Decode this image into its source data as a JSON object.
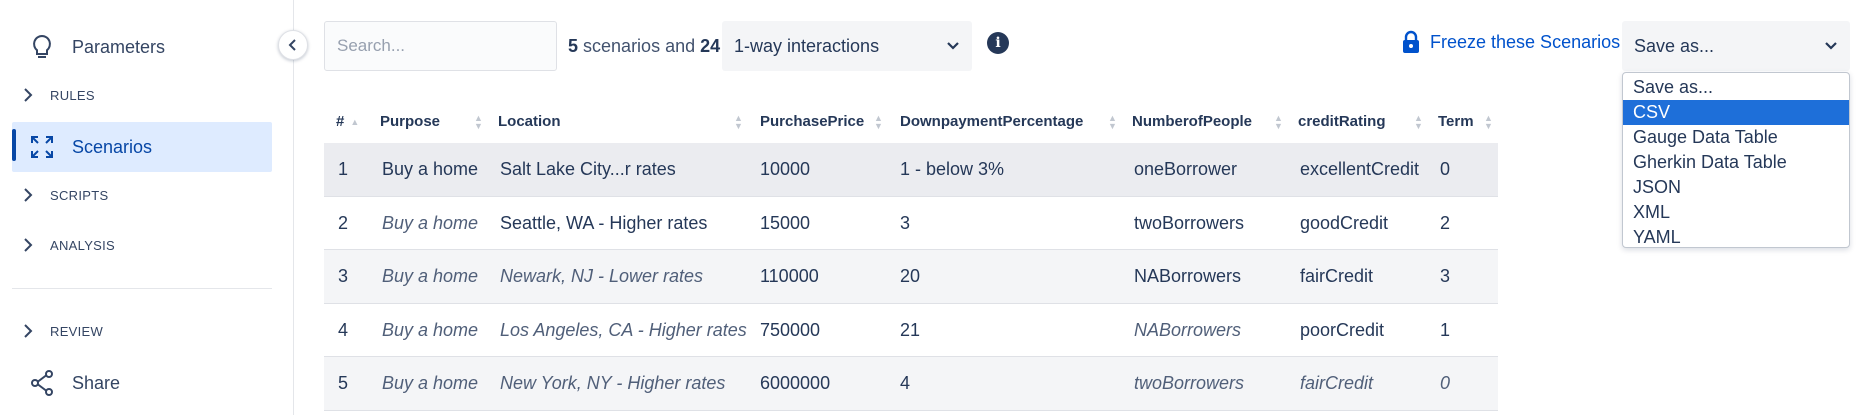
{
  "sidebar": {
    "parameters": "Parameters",
    "rules": "RULES",
    "scenarios": "Scenarios",
    "scripts": "SCRIPTS",
    "analysis": "ANALYSIS",
    "review": "REVIEW",
    "share": "Share"
  },
  "toolbar": {
    "search_placeholder": "Search...",
    "scenario_count": "5",
    "scenario_word": "scenarios and",
    "interaction_count": "24",
    "interaction_select": "1-way interactions",
    "freeze_label": "Freeze these Scenarios",
    "save_as": "Save as..."
  },
  "save_menu": [
    "Save as...",
    "CSV",
    "Gauge Data Table",
    "Gherkin Data Table",
    "JSON",
    "XML",
    "YAML"
  ],
  "table": {
    "headers": [
      "#",
      "Purpose",
      "Location",
      "PurchasePrice",
      "DownpaymentPercentage",
      "NumberofPeople",
      "creditRating",
      "Term"
    ],
    "rows": [
      [
        "1",
        "Buy a home",
        "Salt Lake City...r rates",
        "10000",
        "1 - below 3%",
        "oneBorrower",
        "excellentCredit",
        "0"
      ],
      [
        "2",
        "Buy a home",
        "Seattle, WA - Higher rates",
        "15000",
        "3",
        "twoBorrowers",
        "goodCredit",
        "2"
      ],
      [
        "3",
        "Buy a home",
        "Newark, NJ - Lower rates",
        "110000",
        "20",
        "NABorrowers",
        "fairCredit",
        "3"
      ],
      [
        "4",
        "Buy a home",
        "Los Angeles, CA - Higher rates",
        "750000",
        "21",
        "NABorrowers",
        "poorCredit",
        "1"
      ],
      [
        "5",
        "Buy a home",
        "New York, NY - Higher rates",
        "6000000",
        "4",
        "twoBorrowers",
        "fairCredit",
        "0"
      ]
    ]
  },
  "colors": {
    "accent": "#0052cc",
    "active_bg": "#deebff",
    "menu_selected": "#1e6fd9"
  }
}
